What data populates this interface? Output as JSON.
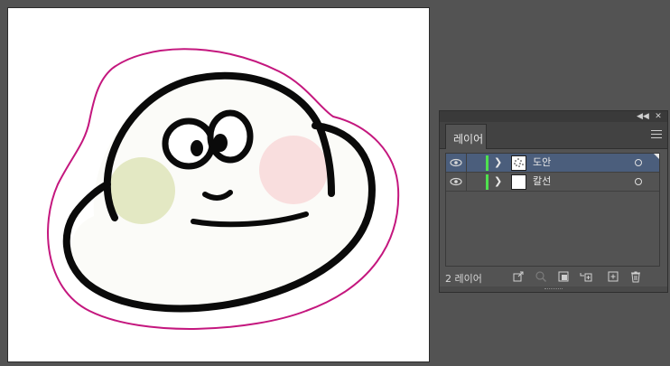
{
  "colors": {
    "workspace": "#535353",
    "outline": "#c4177e",
    "body_fill": "#fbfbf8",
    "cheek_left": "#e3e8c3",
    "cheek_right": "#f9dede",
    "layer_color": "#4fe04f",
    "selected_row": "#4b5e7c"
  },
  "panel": {
    "collapse_icon": "double-chevron-left-icon",
    "close_icon": "close-icon",
    "tab_label": "레이어",
    "menu_icon": "hamburger-menu-icon",
    "layers": [
      {
        "name": "도안",
        "visible": true,
        "selected": true
      },
      {
        "name": "칼선",
        "visible": true,
        "selected": false
      }
    ],
    "footer": {
      "count_label": "2 레이어",
      "icons": [
        "export-icon",
        "search-icon",
        "clipping-mask-icon",
        "new-sublayer-icon",
        "new-layer-icon",
        "trash-icon"
      ]
    }
  }
}
